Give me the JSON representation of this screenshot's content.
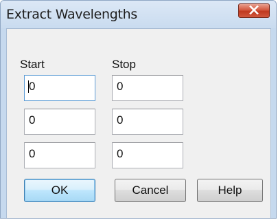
{
  "window": {
    "title": "Extract Wavelengths"
  },
  "columns": {
    "start_label": "Start",
    "stop_label": "Stop"
  },
  "rows": [
    {
      "start": "0",
      "stop": "0"
    },
    {
      "start": "0",
      "stop": "0"
    },
    {
      "start": "0",
      "stop": "0"
    }
  ],
  "buttons": {
    "ok": "OK",
    "cancel": "Cancel",
    "help": "Help"
  },
  "icons": {
    "close": "close-icon"
  },
  "colors": {
    "close_button": "#c73b22",
    "default_button_border": "#3c7fb1",
    "title_bar": "#c9dbef",
    "client_background": "#f0f0f0"
  }
}
